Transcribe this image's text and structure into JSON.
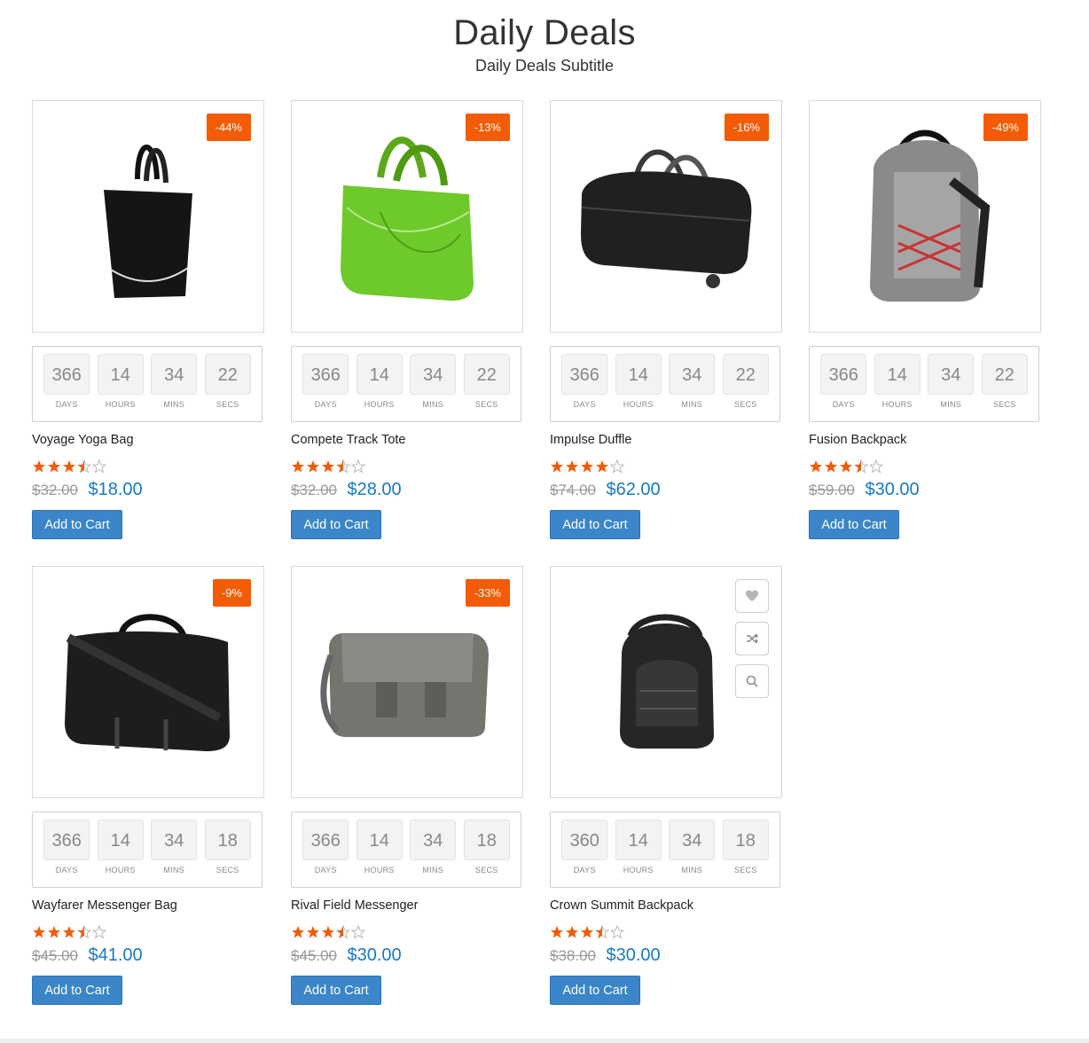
{
  "header": {
    "title": "Daily Deals",
    "subtitle": "Daily Deals Subtitle"
  },
  "colors": {
    "badge": "#f35b04",
    "star": "#f35b04",
    "price": "#1979c3",
    "button": "#3a86c8"
  },
  "countdown_labels": {
    "days": "DAYS",
    "hours": "HOURS",
    "mins": "MINS",
    "secs": "SECS"
  },
  "products": [
    {
      "name": "Voyage Yoga Bag",
      "discount": "-44%",
      "countdown": {
        "days": "366",
        "hours": "14",
        "mins": "34",
        "secs": "22"
      },
      "rating": 3.5,
      "old_price": "$32.00",
      "price": "$18.00",
      "button": "Add to Cart",
      "image_icon": "tote-bag-black"
    },
    {
      "name": "Compete Track Tote",
      "discount": "-13%",
      "countdown": {
        "days": "366",
        "hours": "14",
        "mins": "34",
        "secs": "22"
      },
      "rating": 3.5,
      "old_price": "$32.00",
      "price": "$28.00",
      "button": "Add to Cart",
      "image_icon": "tote-bag-green"
    },
    {
      "name": "Impulse Duffle",
      "discount": "-16%",
      "countdown": {
        "days": "366",
        "hours": "14",
        "mins": "34",
        "secs": "22"
      },
      "rating": 4,
      "old_price": "$74.00",
      "price": "$62.00",
      "button": "Add to Cart",
      "image_icon": "duffle-bag"
    },
    {
      "name": "Fusion Backpack",
      "discount": "-49%",
      "countdown": {
        "days": "366",
        "hours": "14",
        "mins": "34",
        "secs": "22"
      },
      "rating": 3.5,
      "old_price": "$59.00",
      "price": "$30.00",
      "button": "Add to Cart",
      "image_icon": "backpack-gray"
    },
    {
      "name": "Wayfarer Messenger Bag",
      "discount": "-9%",
      "countdown": {
        "days": "366",
        "hours": "14",
        "mins": "34",
        "secs": "18"
      },
      "rating": 3.5,
      "old_price": "$45.00",
      "price": "$41.00",
      "button": "Add to Cart",
      "image_icon": "messenger-bag-black"
    },
    {
      "name": "Rival Field Messenger",
      "discount": "-33%",
      "countdown": {
        "days": "366",
        "hours": "14",
        "mins": "34",
        "secs": "18"
      },
      "rating": 3.5,
      "old_price": "$45.00",
      "price": "$30.00",
      "button": "Add to Cart",
      "image_icon": "messenger-bag-gray"
    },
    {
      "name": "Crown Summit Backpack",
      "discount": "",
      "countdown": {
        "days": "360",
        "hours": "14",
        "mins": "34",
        "secs": "18"
      },
      "rating": 3.5,
      "old_price": "$38.00",
      "price": "$30.00",
      "button": "Add to Cart",
      "image_icon": "backpack-black",
      "hover_actions": [
        "heart-icon",
        "compare-icon",
        "search-icon"
      ]
    }
  ]
}
